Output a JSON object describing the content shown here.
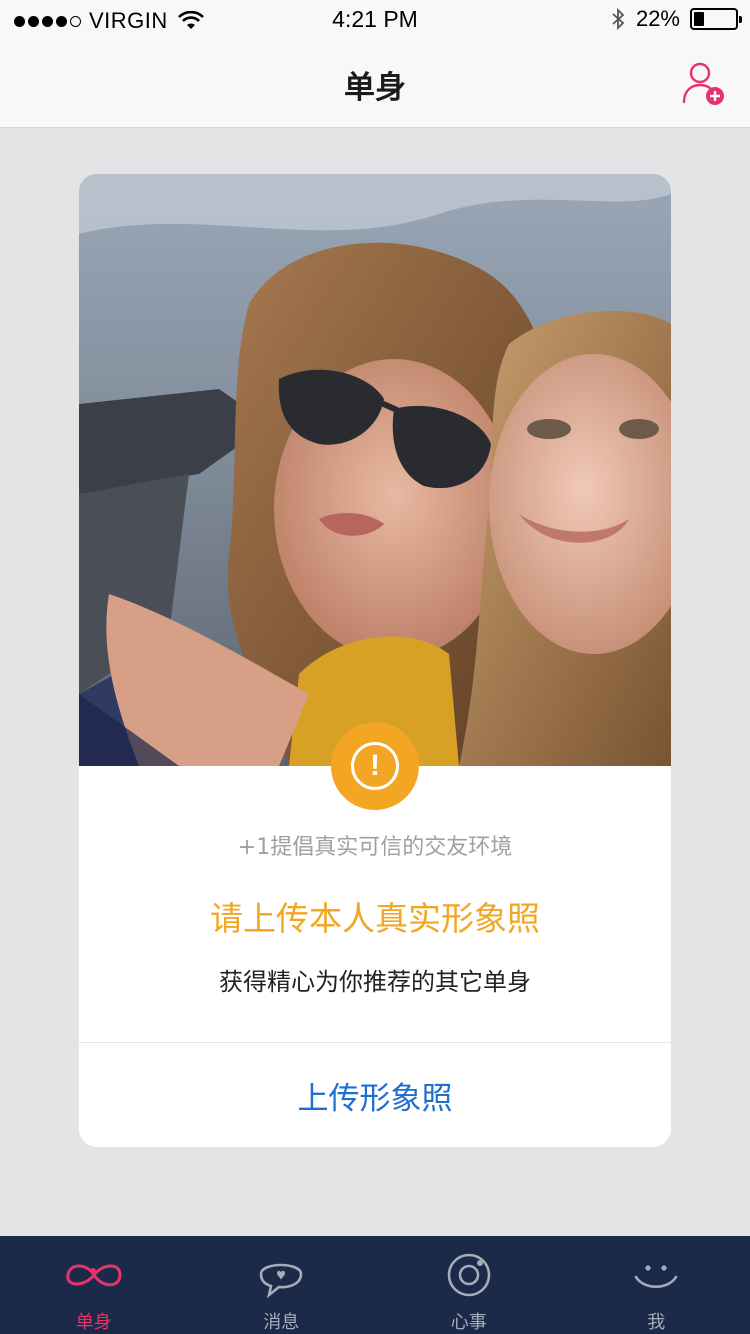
{
  "status_bar": {
    "carrier": "VIRGIN",
    "time": "4:21 PM",
    "battery": "22%",
    "signal_strength": 4,
    "battery_level": 0.22
  },
  "nav": {
    "title": "单身",
    "right_icon": "add-friend-icon"
  },
  "card": {
    "hint": "+1提倡真实可信的交友环境",
    "headline": "请上传本人真实形象照",
    "subline": "获得精心为你推荐的其它单身",
    "upload_label": "上传形象照",
    "badge_symbol": "!"
  },
  "tabs": [
    {
      "label": "单身",
      "icon": "infinity-icon",
      "active": true
    },
    {
      "label": "消息",
      "icon": "chat-bubble-icon",
      "active": false
    },
    {
      "label": "心事",
      "icon": "camera-lens-icon",
      "active": false
    },
    {
      "label": "我",
      "icon": "smiley-icon",
      "active": false
    }
  ],
  "colors": {
    "accent_pink": "#e8336a",
    "warning_orange": "#f2a623",
    "link_blue": "#1f6fcf",
    "tab_bar_bg": "#1b2a48",
    "tab_inactive": "#a6acb8",
    "page_bg": "#e4e4e6"
  }
}
